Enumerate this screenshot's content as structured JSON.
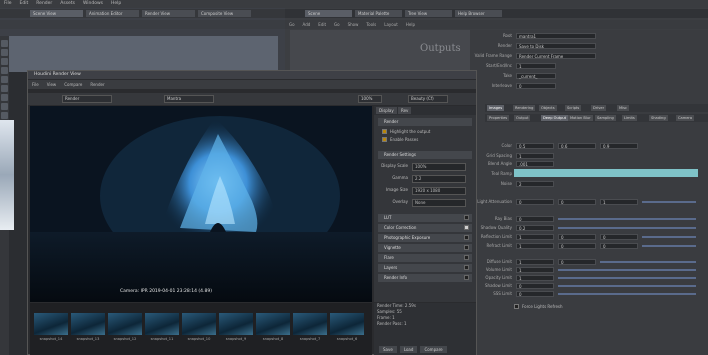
{
  "menubar": [
    "File",
    "Edit",
    "Render",
    "Assets",
    "Windows",
    "Help"
  ],
  "left_tabs": [
    "Scene View",
    "Animation Editor",
    "Render View",
    "Composite View"
  ],
  "right_tabs": [
    "Scene",
    "Material Palette",
    "Tree View",
    "Help Browser"
  ],
  "right_toolbar": [
    "Go",
    "Add",
    "Edit",
    "Go",
    "Show",
    "Tools",
    "Layout",
    "Help"
  ],
  "network": {
    "title": "Outputs"
  },
  "render_view": {
    "title": "Houdini Render View",
    "menu": [
      "File",
      "View",
      "Compare",
      "Render"
    ],
    "toolbar_dropdown": "Render",
    "toolbar_dropdown2": "Mantra",
    "zoom": "100%",
    "aov": "Beauty (Cf)",
    "side_tabs": [
      "Display",
      "Rev"
    ],
    "sections": [
      {
        "label": "Render",
        "checked": false
      },
      {
        "label": "Render Settings",
        "checked": false
      },
      {
        "label": "LUT",
        "checked": false
      },
      {
        "label": "Color Correction",
        "checked": true
      },
      {
        "label": "Photographic Exposure",
        "checked": false
      },
      {
        "label": "Vignette",
        "checked": false
      },
      {
        "label": "Flare",
        "checked": false
      },
      {
        "label": "Layers",
        "checked": false
      },
      {
        "label": "Render Info",
        "checked": false
      }
    ],
    "display_options": [
      "Highlight the output",
      "Enable Passes"
    ],
    "resolution_label": "Display Scale",
    "resolution_value": "100%",
    "gamma_label": "Gamma",
    "gamma_value": "2.2",
    "image_size_label": "Image Size",
    "image_size_value": "1920 x 1080",
    "overlay_label": "Overlay",
    "overlay_value": "None",
    "caption": "Camera: IPR  2019-04-01  23:28:14  (4.89)",
    "thumbnails": [
      "snapshot_14",
      "snapshot_13",
      "snapshot_12",
      "snapshot_11",
      "snapshot_10",
      "snapshot_9",
      "snapshot_8",
      "snapshot_7",
      "snapshot_6"
    ],
    "stats": [
      "Render Time: 2.59s",
      "Samples: 55",
      "Frame: 1",
      "Render Pass: 1"
    ],
    "bottom_buttons": [
      "Save",
      "Load",
      "Compare"
    ]
  },
  "params": {
    "top_fields": [
      {
        "label": "Root",
        "value": "mantra1"
      },
      {
        "label": "Render",
        "value": "Save to Disk"
      },
      {
        "label": "Valid Frame Range",
        "value": "Render Current Frame"
      },
      {
        "label": "Start/End/Inc",
        "value": "1"
      },
      {
        "label": "Take",
        "value": "_current_"
      },
      {
        "label": "Interleave",
        "value": "0"
      }
    ],
    "tabs": [
      "Images",
      "Rendering",
      "Objects",
      "Scripts",
      "Driver",
      "Misc"
    ],
    "sub_tabs": [
      "Properties",
      "Output",
      "Deep Output",
      "Motion Blur",
      "Sampling",
      "Limits",
      "Shading",
      "Camera"
    ],
    "rows": [
      {
        "label": "Color",
        "values": [
          "0.5",
          "0.6",
          "0.9"
        ]
      },
      {
        "label": "Grid Spacing",
        "values": [
          "1"
        ]
      },
      {
        "label": "Blend Angle",
        "values": [
          ".001"
        ]
      },
      {
        "label": "Teal Ramp",
        "values": [
          "1.00"
        ]
      },
      {
        "label": "Noise",
        "values": [
          "2"
        ]
      },
      {
        "label": "Light Attenuation",
        "values": [
          "0",
          "0",
          "1"
        ]
      },
      {
        "label": "Ray Bias",
        "values": [
          "0"
        ]
      },
      {
        "label": "Shadow Quality",
        "values": [
          "0.2"
        ]
      },
      {
        "label": "Reflection Limit",
        "values": [
          "1",
          "0",
          "0"
        ]
      },
      {
        "label": "Refract Limit",
        "values": [
          "1",
          "0",
          "0"
        ]
      },
      {
        "label": "Diffuse Limit",
        "values": [
          "1",
          "0"
        ]
      },
      {
        "label": "Volume Limit",
        "values": [
          "1"
        ]
      },
      {
        "label": "Opacity Limit",
        "values": [
          "1"
        ]
      },
      {
        "label": "Shadow Limit",
        "values": [
          "0"
        ]
      },
      {
        "label": "SSS Limit",
        "values": [
          "0"
        ]
      }
    ],
    "bottom_check": "Force Lights Refresh"
  }
}
